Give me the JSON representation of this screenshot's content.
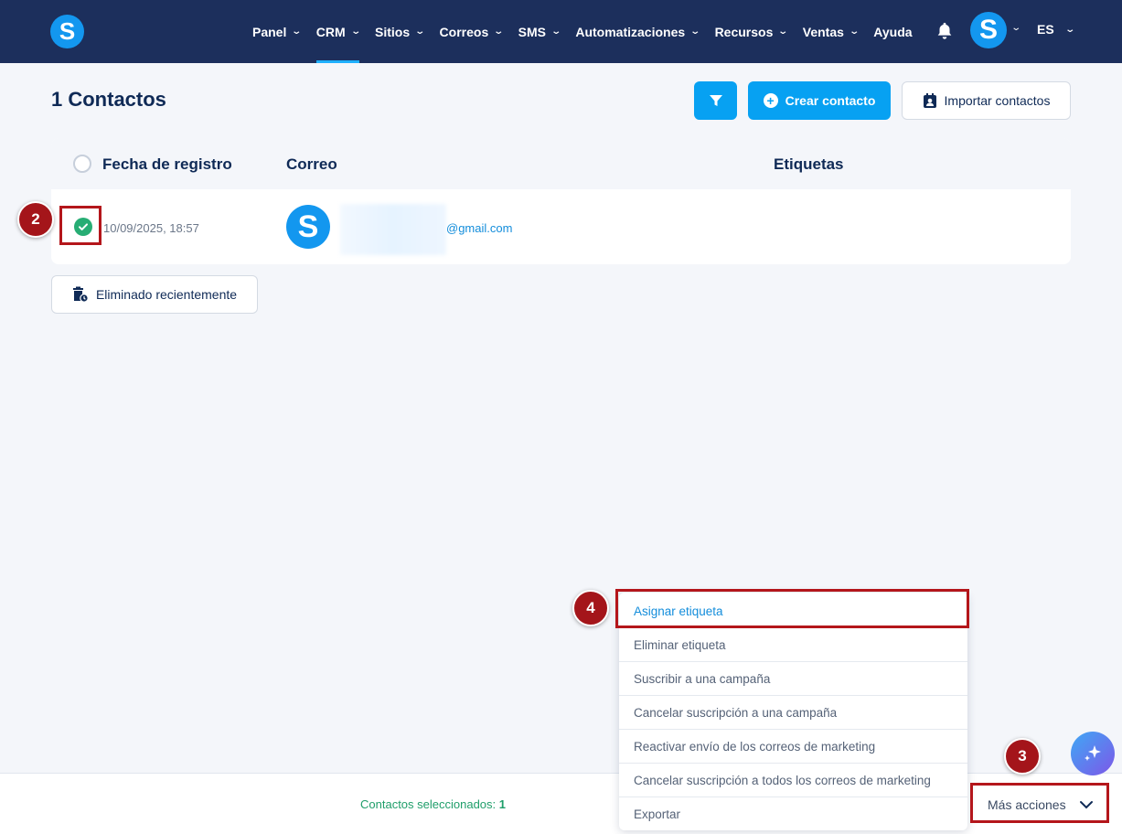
{
  "brand": {
    "logo_letter": "S",
    "primary": "#07a1f2",
    "nav_bg": "#1c2f5c"
  },
  "nav": {
    "items": [
      {
        "label": "Panel",
        "has_menu": true
      },
      {
        "label": "CRM",
        "has_menu": true,
        "active": true
      },
      {
        "label": "Sitios",
        "has_menu": true
      },
      {
        "label": "Correos",
        "has_menu": true
      },
      {
        "label": "SMS",
        "has_menu": true
      },
      {
        "label": "Automatizaciones",
        "has_menu": true
      },
      {
        "label": "Recursos",
        "has_menu": true
      },
      {
        "label": "Ventas",
        "has_menu": true
      },
      {
        "label": "Ayuda",
        "has_menu": false
      }
    ],
    "notifications_icon": "bell-icon",
    "user_avatar_letter": "S",
    "language": "ES"
  },
  "page": {
    "title": "1 Contactos",
    "filter_icon": "filter-icon",
    "create_label": "Crear contacto",
    "import_label": "Importar contactos",
    "deleted_label": "Eliminado recientemente"
  },
  "table": {
    "columns": [
      "Fecha de registro",
      "Correo",
      "Etiquetas"
    ],
    "rows": [
      {
        "selected": true,
        "date": "10/09/2025, 18:57",
        "avatar_letter": "S",
        "email": "@gmail.com",
        "tags": ""
      }
    ]
  },
  "bottom_bar": {
    "selected_label": "Contactos seleccionados:",
    "selected_count": "1",
    "more_actions_label": "Más acciones"
  },
  "actions_menu": [
    "Asignar etiqueta",
    "Eliminar etiqueta",
    "Suscribir a una campaña",
    "Cancelar suscripción a una campaña",
    "Reactivar envío de los correos de marketing",
    "Cancelar suscripción a todos los correos de marketing",
    "Exportar"
  ],
  "annotations": [
    {
      "number": "2",
      "color": "#a4151a"
    },
    {
      "number": "3",
      "color": "#a4151a"
    },
    {
      "number": "4",
      "color": "#a4151a"
    }
  ]
}
